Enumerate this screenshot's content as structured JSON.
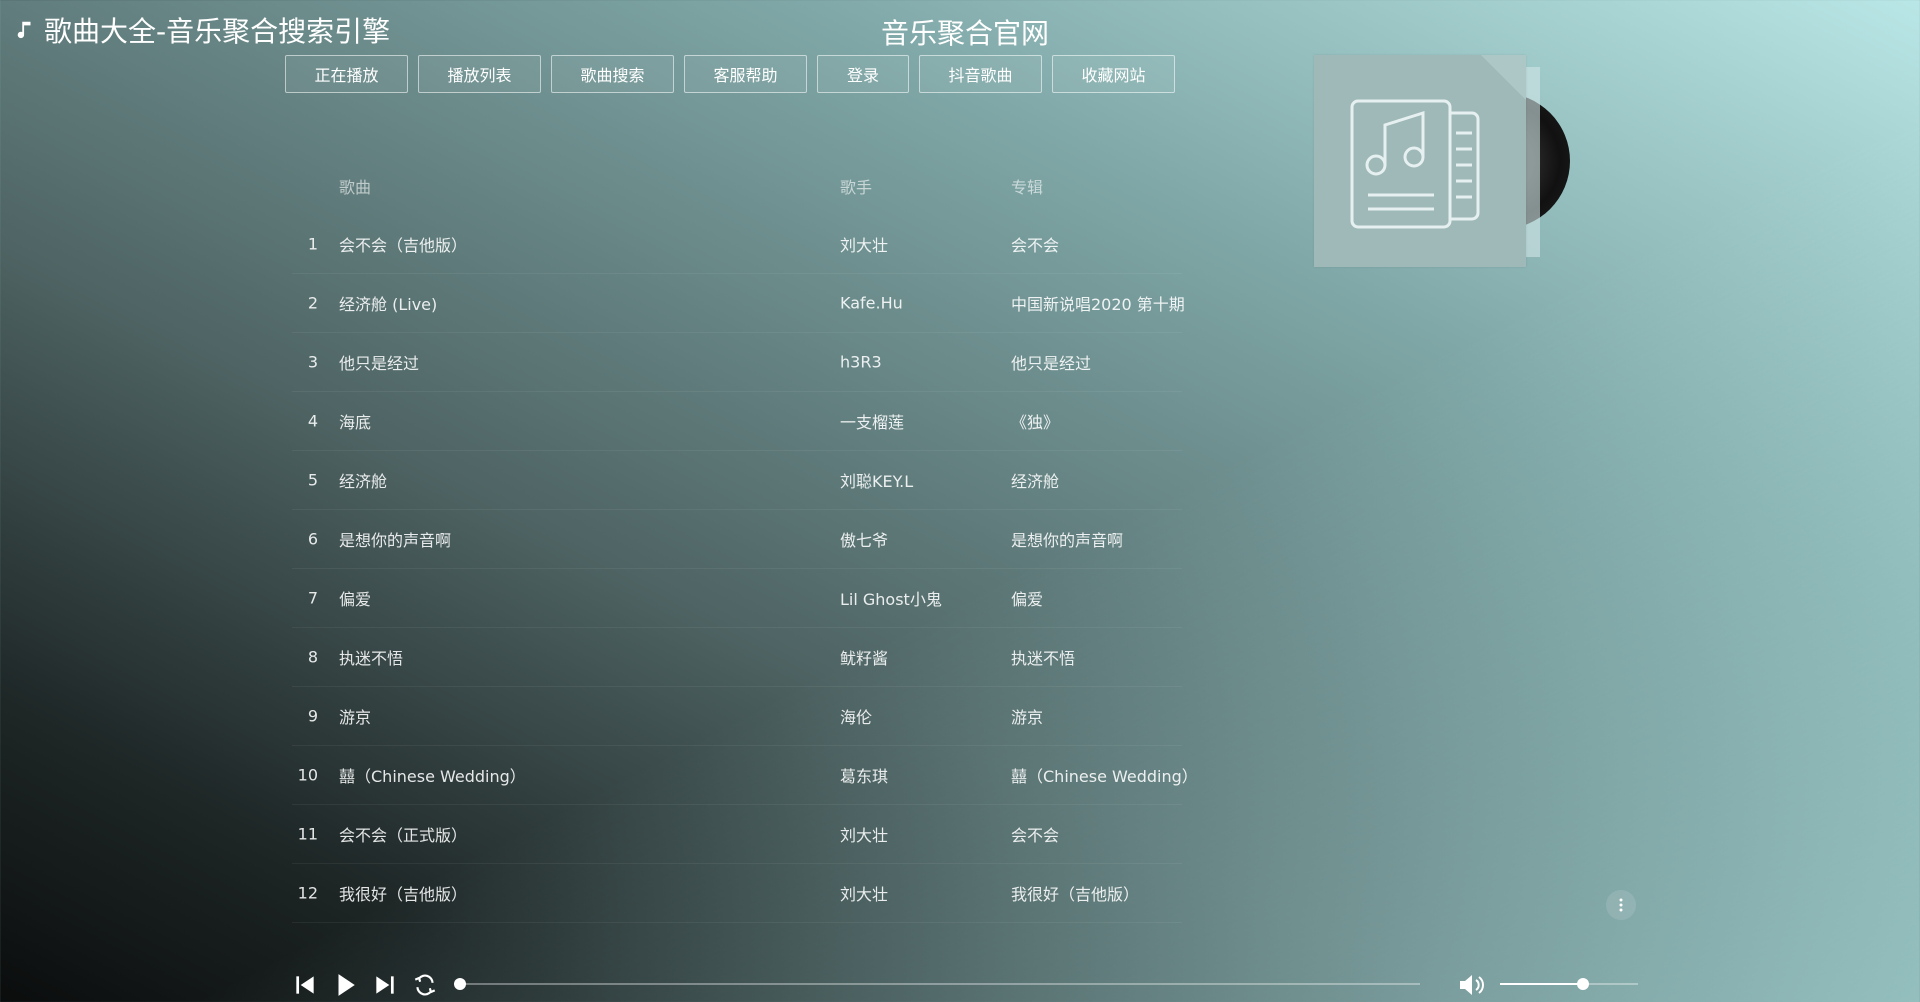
{
  "header": {
    "site_title": "歌曲大全-音乐聚合搜索引擎",
    "center_title": "音乐聚合官网"
  },
  "nav": {
    "items": [
      {
        "label": "正在播放",
        "key": "now-playing"
      },
      {
        "label": "播放列表",
        "key": "playlist"
      },
      {
        "label": "歌曲搜索",
        "key": "song-search"
      },
      {
        "label": "客服帮助",
        "key": "help"
      },
      {
        "label": "登录",
        "key": "login"
      },
      {
        "label": "抖音歌曲",
        "key": "douyin-songs"
      },
      {
        "label": "收藏网站",
        "key": "bookmark"
      }
    ]
  },
  "table": {
    "headers": {
      "song": "歌曲",
      "artist": "歌手",
      "album": "专辑"
    },
    "rows": [
      {
        "num": "1",
        "song": "会不会（吉他版）",
        "artist": "刘大壮",
        "album": "会不会"
      },
      {
        "num": "2",
        "song": "经济舱 (Live)",
        "artist": "Kafe.Hu",
        "album": "中国新说唱2020 第十期"
      },
      {
        "num": "3",
        "song": "他只是经过",
        "artist": "h3R3",
        "album": "他只是经过"
      },
      {
        "num": "4",
        "song": "海底",
        "artist": "一支榴莲",
        "album": "《独》"
      },
      {
        "num": "5",
        "song": "经济舱",
        "artist": "刘聪KEY.L",
        "album": "经济舱"
      },
      {
        "num": "6",
        "song": "是想你的声音啊",
        "artist": "傲七爷",
        "album": "是想你的声音啊"
      },
      {
        "num": "7",
        "song": "偏爱",
        "artist": "Lil Ghost小鬼",
        "album": "偏爱"
      },
      {
        "num": "8",
        "song": "执迷不悟",
        "artist": "鱿籽酱",
        "album": "执迷不悟"
      },
      {
        "num": "9",
        "song": "游京",
        "artist": "海伦",
        "album": "游京"
      },
      {
        "num": "10",
        "song": "囍（Chinese Wedding）",
        "artist": "葛东琪",
        "album": "囍（Chinese Wedding）"
      },
      {
        "num": "11",
        "song": "会不会（正式版）",
        "artist": "刘大壮",
        "album": "会不会"
      },
      {
        "num": "12",
        "song": "我很好（吉他版）",
        "artist": "刘大壮",
        "album": "我很好（吉他版）"
      }
    ]
  },
  "album_art": {
    "icon": "music-document-icon"
  },
  "player": {
    "progress_fraction": 0.0,
    "volume_fraction": 0.6,
    "icons": {
      "prev": "skip-previous-icon",
      "play": "play-icon",
      "next": "skip-next-icon",
      "loop": "loop-icon",
      "volume": "volume-icon",
      "more": "more-vertical-icon"
    }
  },
  "colors": {
    "text": "#ffffff",
    "cover": "#9fb8b8"
  }
}
